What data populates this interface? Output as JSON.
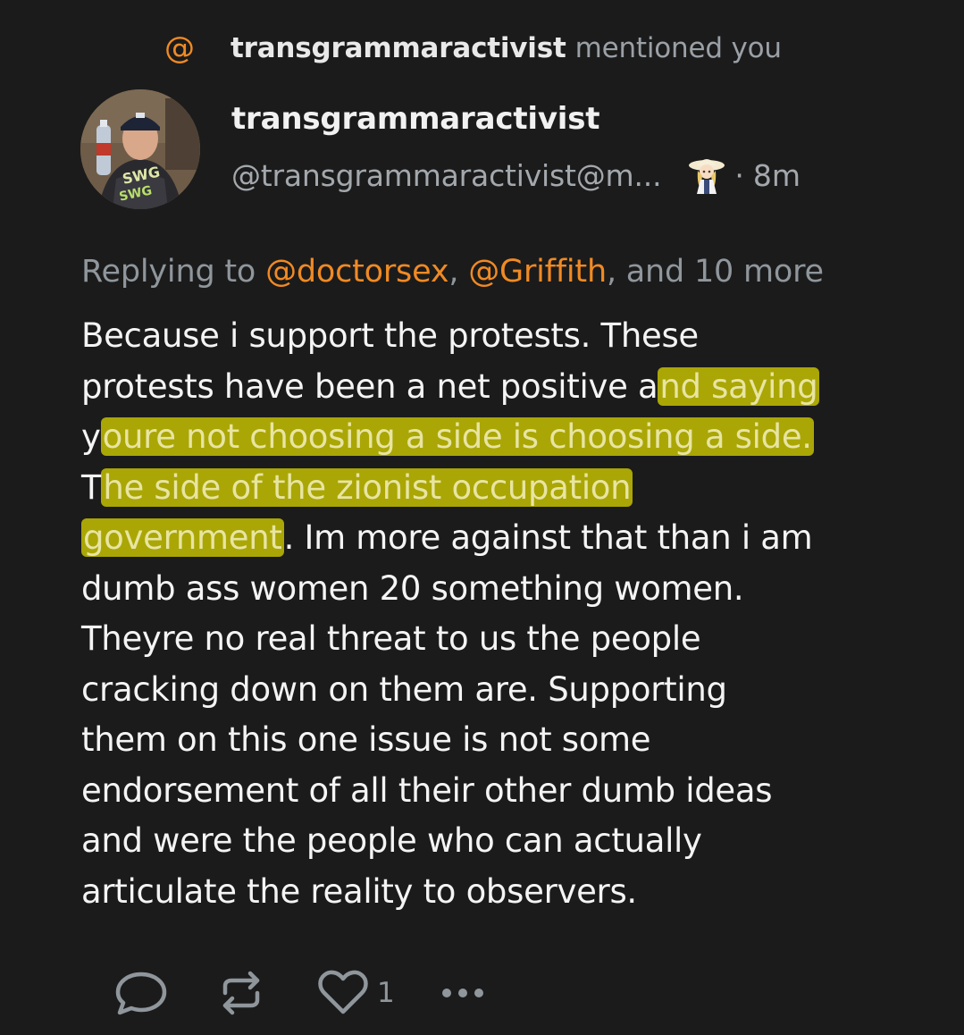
{
  "notification": {
    "icon": "at-sign-icon",
    "user": "transgrammaractivist",
    "text": "mentioned you",
    "accent_color": "#f08a24"
  },
  "post": {
    "display_name": "transgrammaractivist",
    "handle": "@transgrammaractivist@m...",
    "separator": "·",
    "timestamp": "8m",
    "replying": {
      "prefix": "Replying to",
      "mention1": "@doctorsex",
      "comma1": ",",
      "mention2": "@Griffith",
      "suffix": ", and 10 more"
    },
    "body_lines": [
      {
        "plain_a": "Because i support the protests. These",
        "hl": "",
        "plain_b": ""
      },
      {
        "plain_a": "protests have been a net positive a",
        "hl": "nd saying",
        "plain_b": ""
      },
      {
        "plain_a": "y",
        "hl": "oure not choosing a side is choosing a side.",
        "plain_b": ""
      },
      {
        "plain_a": "T",
        "hl": "he side of the zionist occupation",
        "plain_b": ""
      },
      {
        "plain_a": "",
        "hl": "government",
        "plain_b": ". Im more against that than i am"
      },
      {
        "plain_a": "dumb ass women 20 something women.",
        "hl": "",
        "plain_b": ""
      },
      {
        "plain_a": "Theyre no real threat to us the people",
        "hl": "",
        "plain_b": ""
      },
      {
        "plain_a": "cracking down on them are. Supporting",
        "hl": "",
        "plain_b": ""
      },
      {
        "plain_a": "them on this one issue is not some",
        "hl": "",
        "plain_b": ""
      },
      {
        "plain_a": "endorsement of all their other dumb ideas",
        "hl": "",
        "plain_b": ""
      },
      {
        "plain_a": "and were the people who can actually",
        "hl": "",
        "plain_b": ""
      },
      {
        "plain_a": "articulate the reality to observers.",
        "hl": "",
        "plain_b": ""
      }
    ],
    "highlight_color": "#d2cd00",
    "actions": {
      "reply_icon": "speech-bubble-icon",
      "boost_icon": "repeat-icon",
      "like_icon": "heart-icon",
      "like_count": "1",
      "more_icon": "more-dots-icon"
    }
  }
}
